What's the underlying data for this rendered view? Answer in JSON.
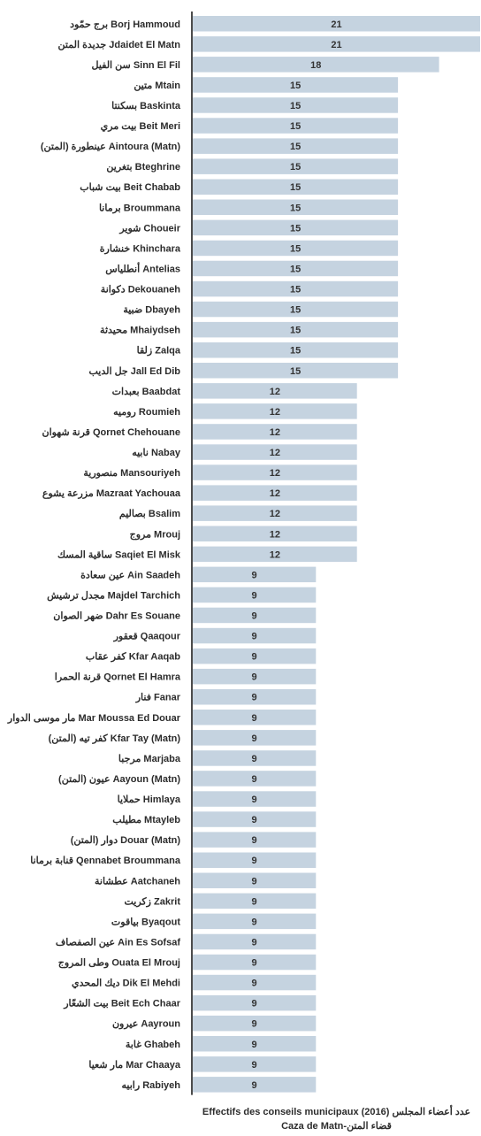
{
  "chart_data": {
    "type": "bar",
    "orientation": "horizontal",
    "title": "Effectifs des conseils municipaux (2016) عدد أعضاء المجلس",
    "subtitle": "Caza de Matn-قضاء المتن",
    "xlabel": "",
    "ylabel": "",
    "xlim": [
      0,
      21
    ],
    "grid": false,
    "legend": "none",
    "bar_color": "#c5d3e0",
    "categories": [
      "برج حمّود Borj Hammoud",
      "جديدة المتن Jdaidet El Matn",
      "سن الفيل Sinn El Fil",
      "متين Mtain",
      "بسكنتا Baskinta",
      "بيت مري Beit Meri",
      "عينطورة (المتن) Aintoura (Matn)",
      "بتغرين Bteghrine",
      "بيت شباب Beit Chabab",
      "برمانا Broummana",
      "شوير Choueir",
      "خنشارة Khinchara",
      "أنطلياس Antelias",
      "دكوانة Dekouaneh",
      "ضبية Dbayeh",
      "محيدثة Mhaiydseh",
      "زلقا Zalqa",
      "جل الديب Jall Ed Dib",
      "بعبدات Baabdat",
      "روميه Roumieh",
      "قرنة شهوان Qornet Chehouane",
      "نابيه Nabay",
      "منصورية Mansouriyeh",
      "مزرعة يشوع Mazraat Yachouaa",
      "بصاليم Bsalim",
      "مروج Mrouj",
      "ساقية المسك Saqiet El Misk",
      "عين سعادة Ain Saadeh",
      "مجدل ترشيش Majdel Tarchich",
      "ضهر الصوان Dahr Es Souane",
      "قعقور Qaaqour",
      "كفر عقاب Kfar Aaqab",
      "قرنة الحمرا Qornet El Hamra",
      "فنار Fanar",
      "مار موسى الدوار Mar Moussa Ed Douar",
      "كفر تيه (المتن) Kfar Tay (Matn)",
      "مرجبا Marjaba",
      "عيون (المتن) Aayoun (Matn)",
      "حملايا Himlaya",
      "مطيلب Mtayleb",
      "دوار (المتن) Douar (Matn)",
      "قنابة برمانا Qennabet Broummana",
      "عطشانة Aatchaneh",
      "زكريت Zakrit",
      "بياقوت Byaqout",
      "عين الصفصاف Ain Es Sofsaf",
      "وطى المروج Ouata El Mrouj",
      "ديك المحدي Dik El Mehdi",
      "بيت الشعّار Beit Ech Chaar",
      "عيرون Aayroun",
      "غابة Ghabeh",
      "مار شعيا Mar Chaaya",
      "رابيه Rabiyeh"
    ],
    "values": [
      21,
      21,
      18,
      15,
      15,
      15,
      15,
      15,
      15,
      15,
      15,
      15,
      15,
      15,
      15,
      15,
      15,
      15,
      12,
      12,
      12,
      12,
      12,
      12,
      12,
      12,
      12,
      9,
      9,
      9,
      9,
      9,
      9,
      9,
      9,
      9,
      9,
      9,
      9,
      9,
      9,
      9,
      9,
      9,
      9,
      9,
      9,
      9,
      9,
      9,
      9,
      9,
      9
    ]
  }
}
